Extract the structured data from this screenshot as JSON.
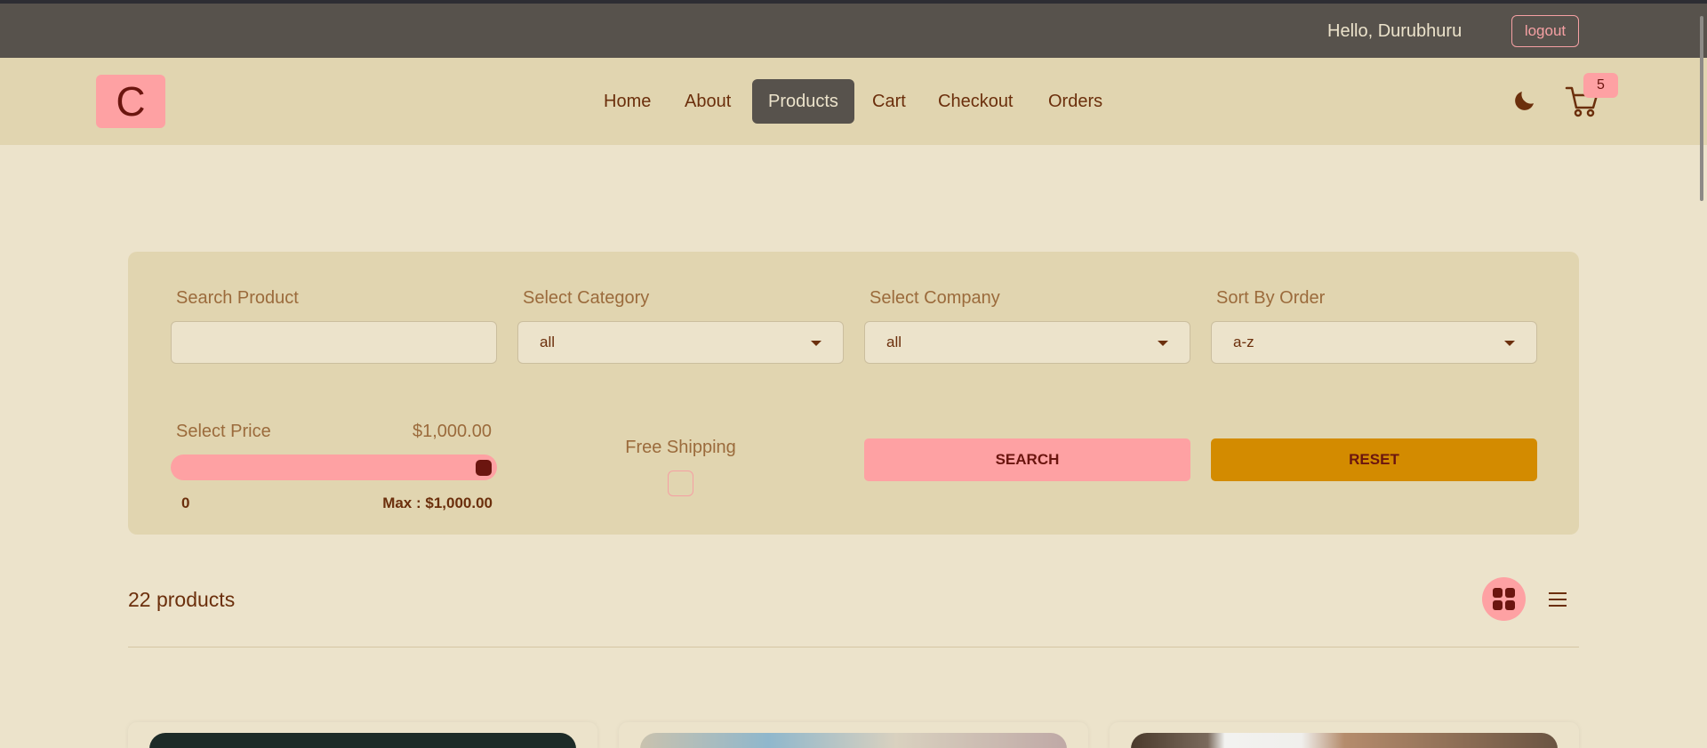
{
  "header": {
    "greeting": "Hello, Durubhuru",
    "logout_label": "logout"
  },
  "navbar": {
    "logo_letter": "C",
    "links": [
      "Home",
      "About",
      "Products",
      "Cart",
      "Checkout",
      "Orders"
    ],
    "active_link": "Products",
    "cart_count": "5",
    "theme_icon": "moon-icon",
    "cart_icon": "cart-icon"
  },
  "filters": {
    "search_label": "Search Product",
    "search_value": "",
    "category_label": "Select Category",
    "category_value": "all",
    "company_label": "Select Company",
    "company_value": "all",
    "sort_label": "Sort By Order",
    "sort_value": "a-z",
    "price_label": "Select Price",
    "price_value": "$1,000.00",
    "price_min": "0",
    "price_max": "Max : $1,000.00",
    "price_fraction": 1.0,
    "shipping_label": "Free Shipping",
    "shipping_checked": false,
    "search_button": "SEARCH",
    "reset_button": "RESET"
  },
  "products": {
    "count_label": "22 products",
    "view_mode": "grid"
  },
  "colors": {
    "accent_pink": "#fea1a3",
    "accent_orange": "#d38b00",
    "dark_brown": "#6b150f",
    "topbar": "#57524c",
    "navbar": "#e1d5b0",
    "background": "#ece3cb"
  }
}
